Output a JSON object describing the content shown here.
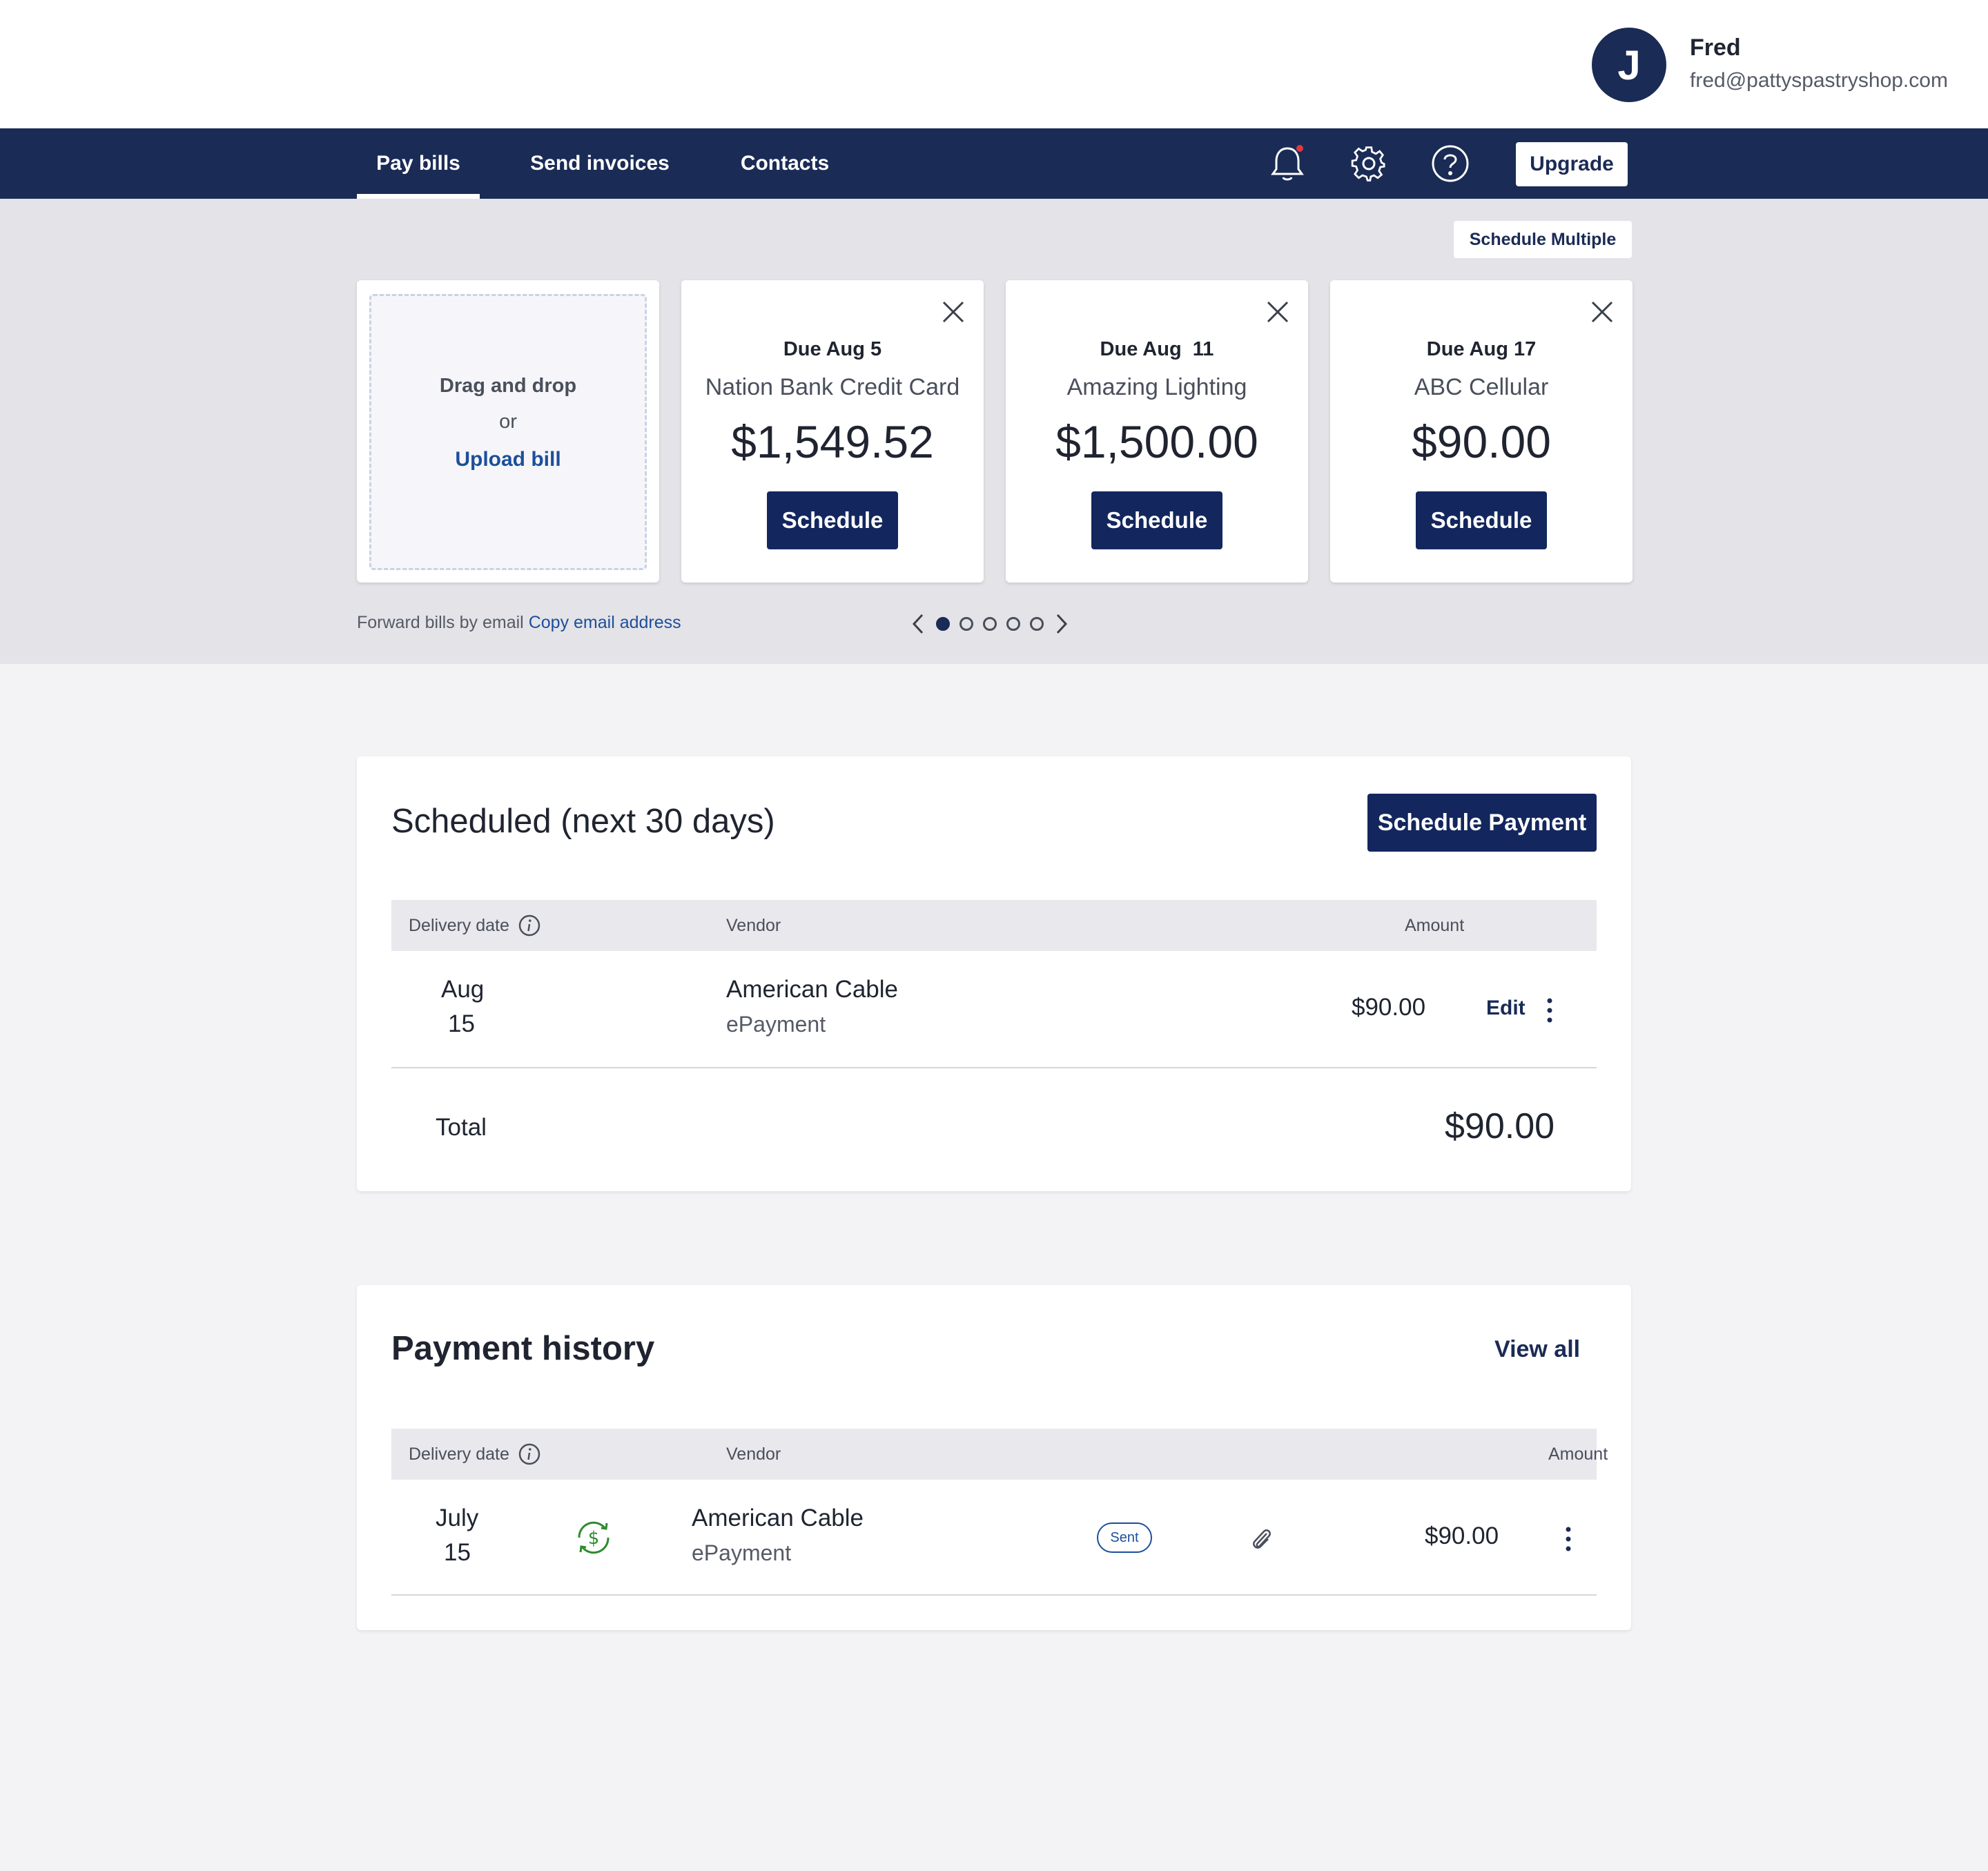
{
  "user": {
    "initial": "J",
    "name": "Fred",
    "email": "fred@pattyspastryshop.com"
  },
  "nav": {
    "tabs": [
      {
        "label": "Pay bills"
      },
      {
        "label": "Send invoices"
      },
      {
        "label": "Contacts"
      }
    ],
    "icons": [
      "bell-icon",
      "gear-icon",
      "help-icon"
    ],
    "upgrade_label": "Upgrade",
    "colors": {
      "nav_bg": "#1a2b55",
      "notification_dot": "#e0383e"
    }
  },
  "bills": {
    "schedule_multiple_label": "Schedule Multiple",
    "upload": {
      "drag_text": "Drag and drop",
      "or_text": "or",
      "upload_link": "Upload bill"
    },
    "cards": [
      {
        "due": "Due Aug 5",
        "vendor": "Nation Bank Credit Card",
        "amount": "$1,549.52",
        "button": "Schedule"
      },
      {
        "due": "Due Aug  11",
        "vendor": "Amazing Lighting",
        "amount": "$1,500.00",
        "button": "Schedule"
      },
      {
        "due": "Due Aug 17",
        "vendor": "ABC Cellular",
        "amount": "$90.00",
        "button": "Schedule"
      }
    ],
    "forward_text": "Forward bills by email",
    "copy_email_link": "Copy email address",
    "pager": {
      "pages": 5,
      "current": 1
    }
  },
  "scheduled": {
    "title": "Scheduled (next 30 days)",
    "schedule_payment_label": "Schedule Payment",
    "headers": {
      "date": "Delivery date",
      "vendor": "Vendor",
      "amount": "Amount"
    },
    "rows": [
      {
        "month": "Aug",
        "day": "15",
        "vendor": "American Cable",
        "method": "ePayment",
        "amount": "$90.00",
        "edit": "Edit"
      }
    ],
    "total_label": "Total",
    "total_value": "$90.00"
  },
  "history": {
    "title": "Payment history",
    "view_all_label": "View all",
    "headers": {
      "date": "Delivery date",
      "vendor": "Vendor",
      "amount": "Amount"
    },
    "rows": [
      {
        "month": "July",
        "day": "15",
        "vendor": "American Cable",
        "method": "ePayment",
        "status": "Sent",
        "amount": "$90.00"
      }
    ]
  }
}
